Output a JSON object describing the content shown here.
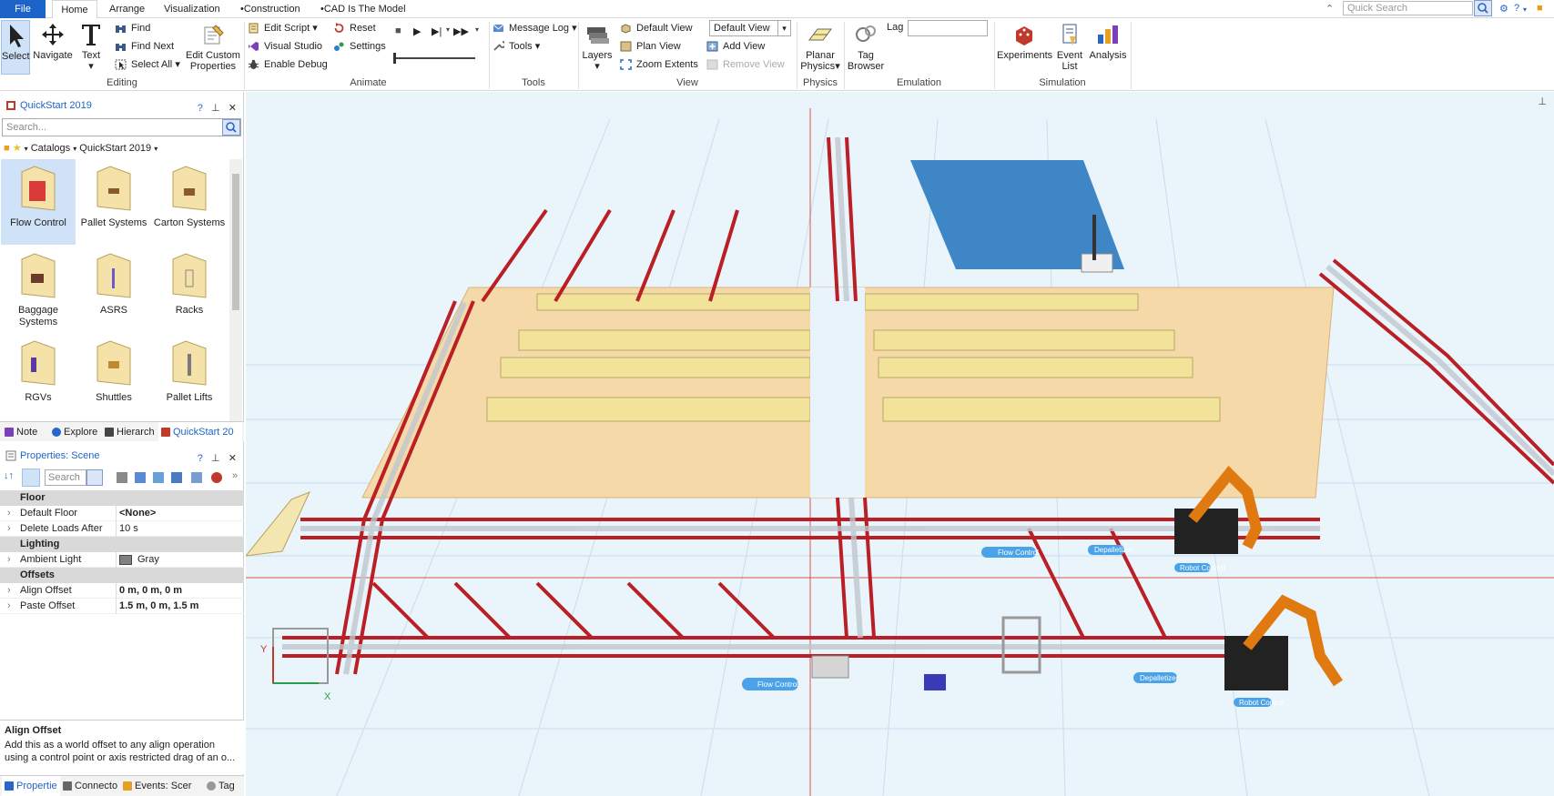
{
  "tabs": {
    "file": "File",
    "home": "Home",
    "arrange": "Arrange",
    "visualization": "Visualization",
    "construction": "Construction",
    "cad": "CAD Is The Model"
  },
  "quick_search": {
    "placeholder": "Quick Search"
  },
  "ribbon": {
    "editing": {
      "label": "Editing",
      "select": "Select",
      "navigate": "Navigate",
      "text": "Text",
      "find": "Find",
      "find_next": "Find Next",
      "select_all": "Select All",
      "edit_custom_props": "Edit Custom Properties"
    },
    "animate": {
      "label": "Animate",
      "edit_script": "Edit Script",
      "visual_studio": "Visual Studio",
      "enable_debug": "Enable Debug",
      "reset": "Reset",
      "settings": "Settings"
    },
    "tools": {
      "label": "Tools",
      "message_log": "Message Log",
      "tools": "Tools"
    },
    "view": {
      "label": "View",
      "layers": "Layers",
      "default_view": "Default View",
      "plan_view": "Plan View",
      "zoom_extents": "Zoom Extents",
      "view_select": "Default View",
      "add_view": "Add View",
      "remove_view": "Remove View"
    },
    "physics": {
      "label": "Physics",
      "planar_physics": "Planar Physics"
    },
    "emulation": {
      "label": "Emulation",
      "tag_browser": "Tag Browser",
      "lag": "Lag"
    },
    "simulation": {
      "label": "Simulation",
      "experiments": "Experiments",
      "event_list": "Event List",
      "analysis": "Analysis"
    }
  },
  "library": {
    "title": "QuickStart 2019",
    "search_placeholder": "Search...",
    "breadcrumb": [
      "Catalogs",
      "QuickStart 2019"
    ],
    "items": [
      {
        "label": "Flow Control",
        "color": "#d93a3a"
      },
      {
        "label": "Pallet Systems",
        "color": "#8a5a2b"
      },
      {
        "label": "Carton Systems",
        "color": "#8a5a2b"
      },
      {
        "label": "Baggage Systems",
        "color": "#6b3a2a"
      },
      {
        "label": "ASRS",
        "color": "#6a5acd"
      },
      {
        "label": "Racks",
        "color": "#888888"
      },
      {
        "label": "RGVs",
        "color": "#5a3aa0"
      },
      {
        "label": "Shuttles",
        "color": "#c08a2a"
      },
      {
        "label": "Pallet Lifts",
        "color": "#7a7a7a"
      }
    ],
    "tabs": [
      "Note",
      "Explore",
      "Hierarch",
      "QuickStart 20"
    ]
  },
  "properties": {
    "title": "Properties: Scene",
    "search_placeholder": "Search",
    "categories": [
      {
        "name": "Floor",
        "rows": [
          {
            "name": "Default Floor",
            "value": "<None>",
            "bold": true
          },
          {
            "name": "Delete Loads After",
            "value": "10 s",
            "bold": false
          }
        ]
      },
      {
        "name": "Lighting",
        "rows": [
          {
            "name": "Ambient Light",
            "value": "Gray",
            "bold": false
          }
        ]
      },
      {
        "name": "Offsets",
        "rows": [
          {
            "name": "Align Offset",
            "value": "0 m, 0 m, 0 m",
            "bold": true
          },
          {
            "name": "Paste Offset",
            "value": "1.5 m, 0 m, 1.5 m",
            "bold": true
          }
        ]
      }
    ],
    "help_title": "Align Offset",
    "help_text": "Add this as a world offset to any align operation using a control point or axis restricted drag of an o...",
    "bottom_tabs": [
      "Propertie",
      "Connecto",
      "Events: Scer",
      "Tag"
    ]
  },
  "scene_labels": {
    "flow_control_1": "Flow Control",
    "flow_control_2": "Flow Control",
    "depalletize_1": "Depalletizer",
    "depalletize_2": "Depalletizer",
    "robot_1": "Robot Control",
    "robot_2": "Robot Control",
    "axis_x": "X",
    "axis_y": "Y"
  },
  "colors": {
    "accent": "#1d64c8",
    "conveyor_red": "#b91f24",
    "rack_yellow": "#f2e39a",
    "floor": "#e8f3fb",
    "mezzanine": "#f5d9a8",
    "robot_orange": "#e07a10"
  }
}
